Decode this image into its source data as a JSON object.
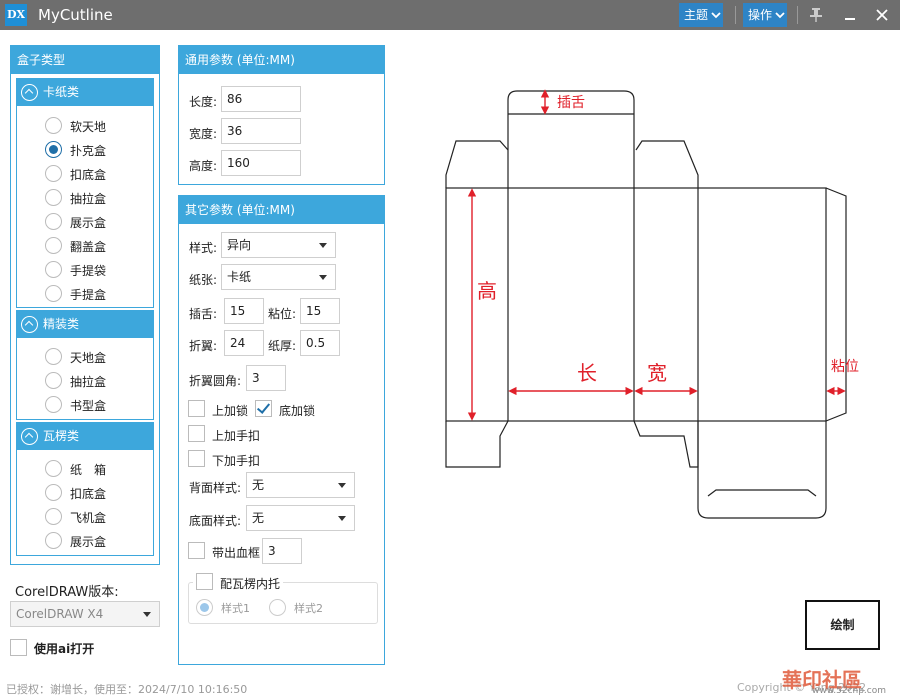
{
  "app": {
    "logo": "DX",
    "title": "MyCutline"
  },
  "titlebar": {
    "menu_theme": "主题",
    "menu_ops": "操作"
  },
  "box_types": {
    "title": "盒子类型",
    "groups": [
      {
        "label": "卡纸类",
        "items": [
          "软天地",
          "扑克盒",
          "扣底盒",
          "抽拉盒",
          "展示盒",
          "翻盖盒",
          "手提袋",
          "手提盒"
        ],
        "selected": 1
      },
      {
        "label": "精装类",
        "items": [
          "天地盒",
          "抽拉盒",
          "书型盒"
        ]
      },
      {
        "label": "瓦楞类",
        "items": [
          "纸　箱",
          "扣底盒",
          "飞机盒",
          "展示盒"
        ]
      }
    ]
  },
  "coreldraw": {
    "label": "CorelDRAW版本:",
    "value": "CorelDRAW X4"
  },
  "open_ai": {
    "label": "使用ai打开",
    "checked": false
  },
  "general": {
    "title": "通用参数 (单位:MM)",
    "length_label": "长度:",
    "length": "86",
    "width_label": "宽度:",
    "width": "36",
    "height_label": "高度:",
    "height": "160"
  },
  "other": {
    "title": "其它参数 (单位:MM)",
    "style_label": "样式:",
    "style": "异向",
    "paper_label": "纸张:",
    "paper": "卡纸",
    "tuck_label": "插舌:",
    "tuck": "15",
    "glue_label": "粘位:",
    "glue": "15",
    "fold_label": "折翼:",
    "fold": "24",
    "thick_label": "纸厚:",
    "thick": "0.5",
    "corner_label": "折翼圆角:",
    "corner": "3",
    "top_lock": {
      "label": "上加锁",
      "checked": false
    },
    "bottom_lock": {
      "label": "底加锁",
      "checked": true
    },
    "top_handle": {
      "label": "上加手扣",
      "checked": false
    },
    "bottom_handle": {
      "label": "下加手扣",
      "checked": false
    },
    "back_label": "背面样式:",
    "back": "无",
    "base_label": "底面样式:",
    "base": "无",
    "bleed": {
      "label": "带出血框",
      "checked": false,
      "value": "3"
    },
    "insert": {
      "label": "配瓦楞内托",
      "checked": false,
      "style1": "样式1",
      "style2": "样式2"
    }
  },
  "diagram": {
    "tuck": "插舌",
    "height": "高",
    "length": "长",
    "width": "宽",
    "glue": "粘位"
  },
  "draw_button": "绘制",
  "status": "已授权：谢增长，使用至：2024/7/10 10:16:50",
  "copyright": "Copyright © Yang 2022",
  "watermark": "華印社區",
  "watermark_url": "www.52cnp.com"
}
